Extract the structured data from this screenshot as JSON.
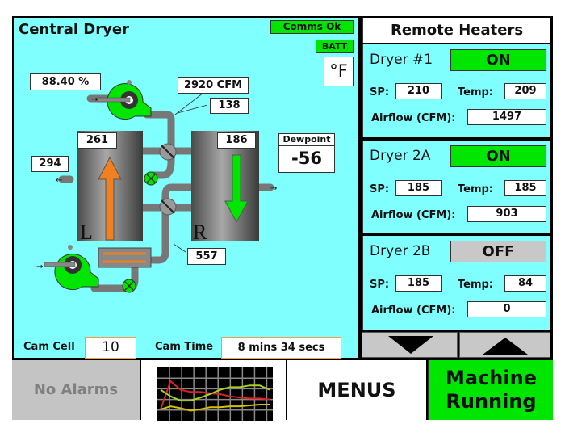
{
  "central_dryer": {
    "title": "Central Dryer",
    "comms_status": "Comms Ok",
    "batt_label": "BATT",
    "temp_unit": "°F",
    "blower_percent": "88.40 %",
    "airflow_cfm": "2920 CFM",
    "process_temp": "138",
    "left_hopper_temp": "261",
    "left_exhaust_temp": "294",
    "left_hopper_label": "L",
    "right_hopper_temp": "186",
    "right_hopper_label": "R",
    "dewpoint_label": "Dewpoint",
    "dewpoint_value": "-56",
    "regen_temp": "557",
    "cam_cell_label": "Cam Cell",
    "cam_cell_value": "10",
    "cam_time_label": "Cam Time",
    "cam_time_value": "8 mins 34 secs"
  },
  "remote_heaters": {
    "title": "Remote Heaters",
    "sp_label": "SP:",
    "temp_label": "Temp:",
    "airflow_label": "Airflow (CFM):",
    "dryers": [
      {
        "name": "Dryer #1",
        "status": "ON",
        "status_color": "#00e600",
        "sp": "210",
        "temp": "209",
        "airflow": "1497"
      },
      {
        "name": "Dryer 2A",
        "status": "ON",
        "status_color": "#00e600",
        "sp": "185",
        "temp": "185",
        "airflow": "903"
      },
      {
        "name": "Dryer 2B",
        "status": "OFF",
        "status_color": "#c8c8c8",
        "sp": "185",
        "temp": "84",
        "airflow": "0"
      }
    ],
    "scroll_down_icon": "triangle-down",
    "scroll_up_icon": "triangle-up"
  },
  "footer": {
    "alarms_label": "No Alarms",
    "trend_icon": "trend-chart-thumbnail",
    "menus_label": "MENUS",
    "machine_status_line1": "Machine",
    "machine_status_line2": "Running"
  },
  "trend_thumbnail": {
    "series": [
      {
        "name": "red",
        "color": "#e02020",
        "values": [
          0.15,
          0.8,
          0.6,
          0.55,
          0.55,
          0.52,
          0.5,
          0.45,
          0.42,
          0.4,
          0.4,
          0.38
        ]
      },
      {
        "name": "lime",
        "color": "#a8d020",
        "values": [
          0.6,
          0.45,
          0.35,
          0.35,
          0.42,
          0.5,
          0.6,
          0.66,
          0.66,
          0.7,
          0.7,
          0.6
        ]
      },
      {
        "name": "yellow",
        "color": "#d8c000",
        "values": [
          0.15,
          0.22,
          0.18,
          0.12,
          0.15,
          0.2,
          0.2,
          0.22,
          0.22,
          0.24,
          0.26,
          0.26
        ]
      }
    ]
  },
  "colors": {
    "panel_bg": "#80ffff",
    "ok_green": "#00e600",
    "off_gray": "#c8c8c8",
    "heater_orange": "#f08020",
    "pipe_gray": "#8a8a8a"
  }
}
